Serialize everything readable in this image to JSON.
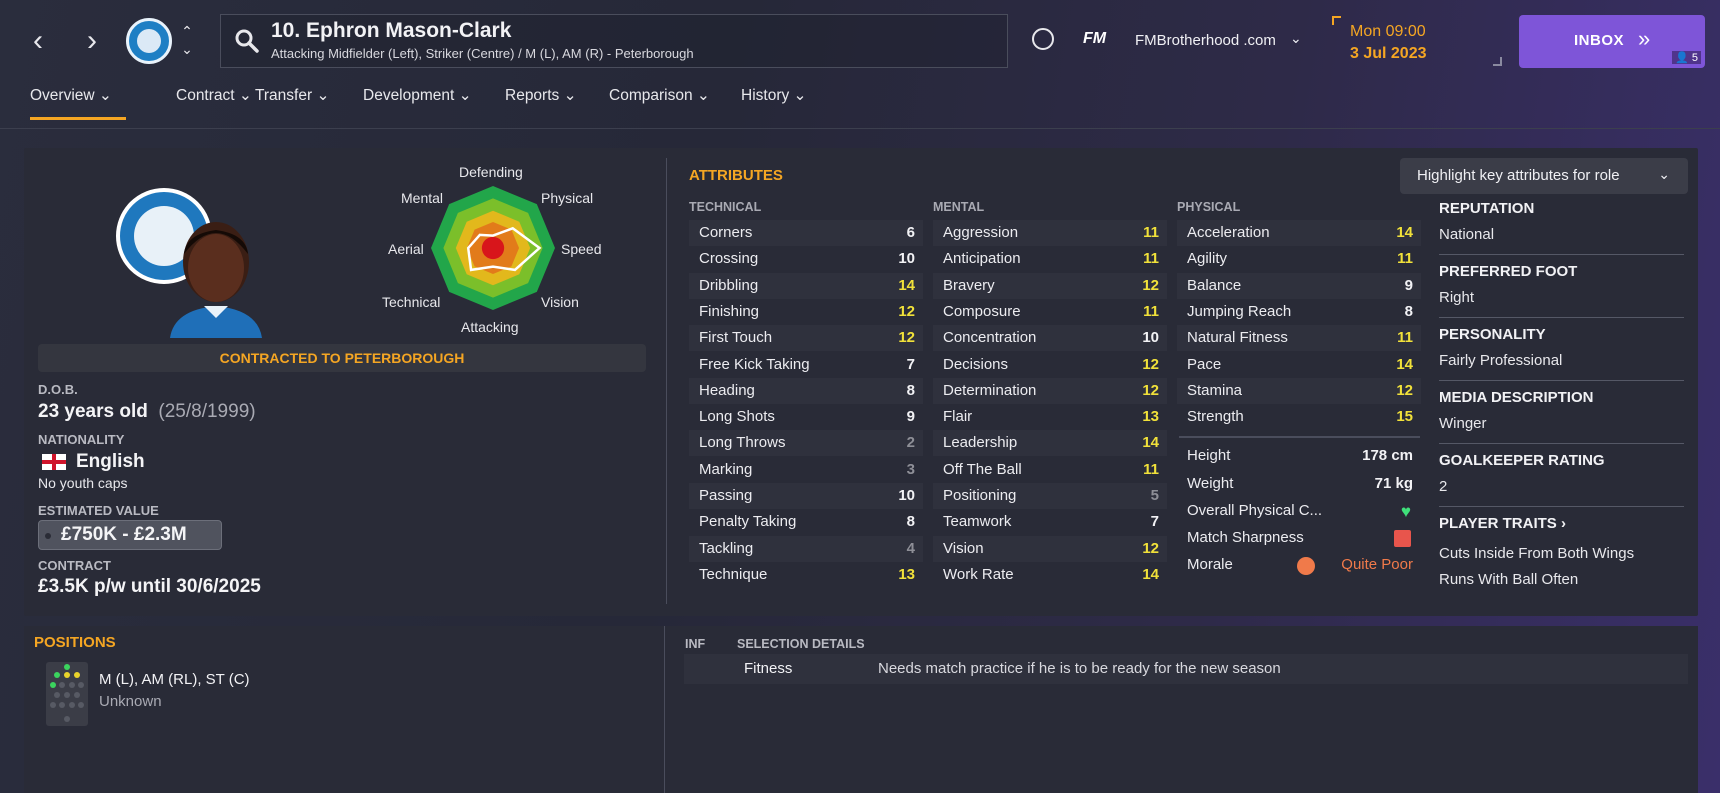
{
  "header": {
    "player_title": "10. Ephron Mason-Clark",
    "player_subtitle": "Attacking Midfielder (Left), Striker (Centre) / M (L), AM (R) - Peterborough",
    "fm_logo": "FM",
    "site_name": "FMBrotherhood .com",
    "time": "Mon 09:00",
    "date": "3 Jul 2023",
    "inbox_label": "INBOX",
    "inbox_count": "5"
  },
  "tabs": [
    {
      "label": "Overview"
    },
    {
      "label": "Contract"
    },
    {
      "label": "Transfer"
    },
    {
      "label": "Development"
    },
    {
      "label": "Reports"
    },
    {
      "label": "Comparison"
    },
    {
      "label": "History"
    }
  ],
  "profile": {
    "contracted_to": "CONTRACTED TO PETERBOROUGH",
    "dob_label": "D.O.B.",
    "age": "23 years old",
    "dob": "(25/8/1999)",
    "nationality_label": "NATIONALITY",
    "nationality": "English",
    "youth_caps": "No youth caps",
    "value_label": "ESTIMATED VALUE",
    "value": "£750K - £2.3M",
    "contract_label": "CONTRACT",
    "contract": "£3.5K p/w until 30/6/2025"
  },
  "radar": {
    "labels": [
      "Defending",
      "Physical",
      "Speed",
      "Vision",
      "Attacking",
      "Technical",
      "Aerial",
      "Mental"
    ],
    "values": [
      0.2,
      0.45,
      0.75,
      0.5,
      0.3,
      0.5,
      0.4,
      0.3
    ]
  },
  "attributes": {
    "title": "ATTRIBUTES",
    "highlight_button": "Highlight key attributes for role",
    "technical_head": "TECHNICAL",
    "mental_head": "MENTAL",
    "physical_head": "PHYSICAL",
    "technical": [
      {
        "name": "Corners",
        "value": "6"
      },
      {
        "name": "Crossing",
        "value": "10"
      },
      {
        "name": "Dribbling",
        "value": "14"
      },
      {
        "name": "Finishing",
        "value": "12"
      },
      {
        "name": "First Touch",
        "value": "12"
      },
      {
        "name": "Free Kick Taking",
        "value": "7"
      },
      {
        "name": "Heading",
        "value": "8"
      },
      {
        "name": "Long Shots",
        "value": "9"
      },
      {
        "name": "Long Throws",
        "value": "2"
      },
      {
        "name": "Marking",
        "value": "3"
      },
      {
        "name": "Passing",
        "value": "10"
      },
      {
        "name": "Penalty Taking",
        "value": "8"
      },
      {
        "name": "Tackling",
        "value": "4"
      },
      {
        "name": "Technique",
        "value": "13"
      }
    ],
    "mental": [
      {
        "name": "Aggression",
        "value": "11"
      },
      {
        "name": "Anticipation",
        "value": "11"
      },
      {
        "name": "Bravery",
        "value": "12"
      },
      {
        "name": "Composure",
        "value": "11"
      },
      {
        "name": "Concentration",
        "value": "10"
      },
      {
        "name": "Decisions",
        "value": "12"
      },
      {
        "name": "Determination",
        "value": "12"
      },
      {
        "name": "Flair",
        "value": "13"
      },
      {
        "name": "Leadership",
        "value": "14"
      },
      {
        "name": "Off The Ball",
        "value": "11"
      },
      {
        "name": "Positioning",
        "value": "5"
      },
      {
        "name": "Teamwork",
        "value": "7"
      },
      {
        "name": "Vision",
        "value": "12"
      },
      {
        "name": "Work Rate",
        "value": "14"
      }
    ],
    "physical": [
      {
        "name": "Acceleration",
        "value": "14"
      },
      {
        "name": "Agility",
        "value": "11"
      },
      {
        "name": "Balance",
        "value": "9"
      },
      {
        "name": "Jumping Reach",
        "value": "8"
      },
      {
        "name": "Natural Fitness",
        "value": "11"
      },
      {
        "name": "Pace",
        "value": "14"
      },
      {
        "name": "Stamina",
        "value": "12"
      },
      {
        "name": "Strength",
        "value": "15"
      }
    ],
    "body": {
      "height_label": "Height",
      "height": "178 cm",
      "weight_label": "Weight",
      "weight": "71 kg",
      "condition_label": "Overall Physical C...",
      "sharpness_label": "Match Sharpness",
      "morale_label": "Morale",
      "morale": "Quite Poor"
    }
  },
  "info": {
    "reputation_label": "REPUTATION",
    "reputation": "National",
    "foot_label": "PREFERRED FOOT",
    "foot": "Right",
    "personality_label": "PERSONALITY",
    "personality": "Fairly Professional",
    "media_label": "MEDIA DESCRIPTION",
    "media": "Winger",
    "gk_label": "GOALKEEPER RATING",
    "gk": "2",
    "traits_label": "PLAYER TRAITS",
    "trait1": "Cuts Inside From Both Wings",
    "trait2": "Runs With Ball Often"
  },
  "positions": {
    "title": "POSITIONS",
    "main": "M (L), AM (RL), ST (C)",
    "sub": "Unknown"
  },
  "selection": {
    "inf_head": "INF",
    "details_head": "SELECTION DETAILS",
    "name": "Fitness",
    "desc": "Needs match practice if he is to be ready for the new season"
  },
  "colors": {
    "accent": "#f5a623",
    "inbox": "#7e55d8",
    "high_attr": "#f1e13a",
    "low_attr": "#8e8f97",
    "good": "#3fe07a",
    "bad": "#f07a4a"
  }
}
